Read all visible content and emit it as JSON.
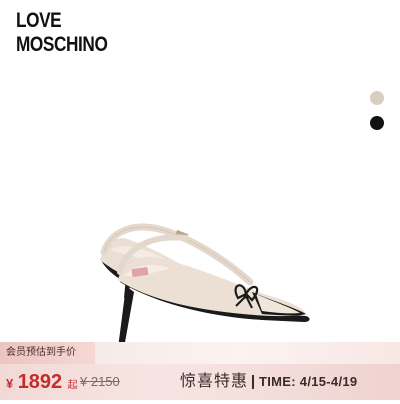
{
  "brand": {
    "line1": "LOVE",
    "line2": "MOSCHINO"
  },
  "color_options": [
    {
      "name": "beige",
      "color": "#d8cdc0"
    },
    {
      "name": "black",
      "color": "#111111"
    }
  ],
  "product_image": {
    "icon": "slingback-pump-image"
  },
  "promo": {
    "member_label": "会员预估到手价",
    "currency": "¥",
    "price": "1892",
    "price_suffix": "起",
    "original_price": "¥ 2150",
    "surprise_label": "惊喜特惠",
    "time_label": "TIME: 4/15-4/19",
    "accent_color": "#c52c2c"
  }
}
